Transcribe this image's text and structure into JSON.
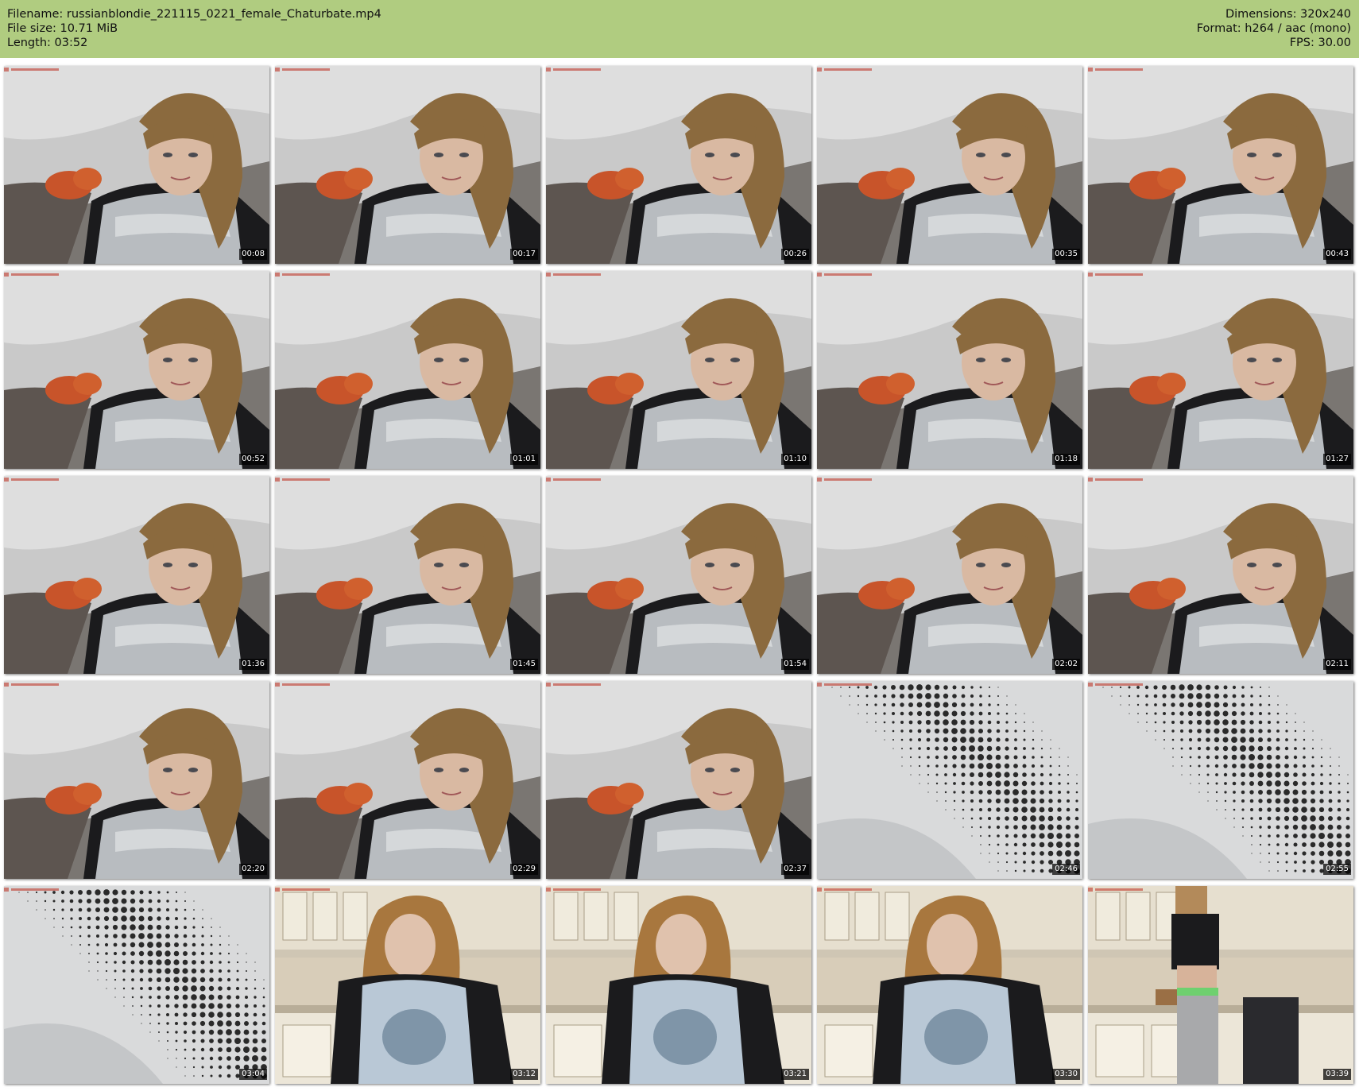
{
  "header": {
    "filename": "Filename: russianblondie_221115_0221_female_Chaturbate.mp4",
    "filesize": "File size: 10.71 MiB",
    "length": "Length: 03:52",
    "dimensions": "Dimensions: 320x240",
    "format": "Format: h264 / aac (mono)",
    "fps": "FPS: 30.00",
    "background_color": "#b0cc80"
  },
  "thumbnails": [
    {
      "time": "00:08",
      "scene": "couch"
    },
    {
      "time": "00:17",
      "scene": "couch"
    },
    {
      "time": "00:26",
      "scene": "couch"
    },
    {
      "time": "00:35",
      "scene": "couch"
    },
    {
      "time": "00:43",
      "scene": "couch"
    },
    {
      "time": "00:52",
      "scene": "couch"
    },
    {
      "time": "01:01",
      "scene": "couch"
    },
    {
      "time": "01:10",
      "scene": "couch"
    },
    {
      "time": "01:18",
      "scene": "couch"
    },
    {
      "time": "01:27",
      "scene": "couch"
    },
    {
      "time": "01:36",
      "scene": "couch"
    },
    {
      "time": "01:45",
      "scene": "couch"
    },
    {
      "time": "01:54",
      "scene": "couch"
    },
    {
      "time": "02:02",
      "scene": "couch"
    },
    {
      "time": "02:11",
      "scene": "couch"
    },
    {
      "time": "02:20",
      "scene": "couch"
    },
    {
      "time": "02:29",
      "scene": "couch"
    },
    {
      "time": "02:37",
      "scene": "couch"
    },
    {
      "time": "02:46",
      "scene": "closeup"
    },
    {
      "time": "02:55",
      "scene": "closeup"
    },
    {
      "time": "03:04",
      "scene": "closeup"
    },
    {
      "time": "03:12",
      "scene": "kitchen"
    },
    {
      "time": "03:21",
      "scene": "kitchen"
    },
    {
      "time": "03:30",
      "scene": "kitchen"
    },
    {
      "time": "03:39",
      "scene": "kitchen-standing"
    }
  ]
}
